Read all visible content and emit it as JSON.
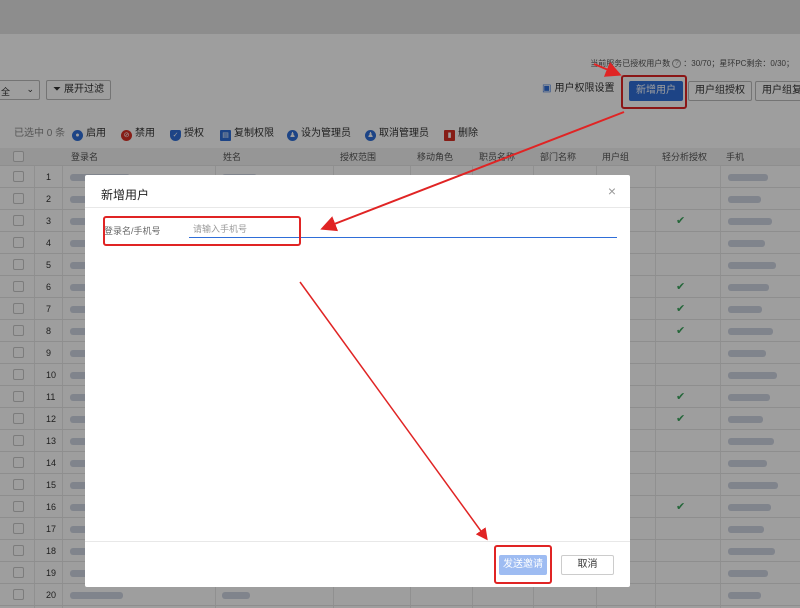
{
  "header": {
    "info_prefix": "当前服务已授权用户数",
    "info_help_icon": "?",
    "info_rest": "：30/70；星环PC剩余：0/30；"
  },
  "filter": {
    "select_value": "全",
    "expand_filter_label": "展开过滤"
  },
  "toolbar": {
    "permission_settings_label": "用户权限设置",
    "new_user_label": "新增用户",
    "group_auth_label": "用户组授权",
    "group_copy_label": "用户组复制"
  },
  "actions": {
    "selected_count": "已选中 0 条",
    "enable": "启用",
    "disable": "禁用",
    "authorize": "授权",
    "copy_permission": "复制权限",
    "set_admin": "设为管理员",
    "unset_admin": "取消管理员",
    "delete": "删除"
  },
  "table": {
    "columns": [
      "登录名",
      "姓名",
      "授权范围",
      "移动角色",
      "职员名称",
      "部门名称",
      "用户组",
      "轻分析授权",
      "手机"
    ],
    "rows": [
      {
        "index": "1",
        "checked": false
      },
      {
        "index": "2",
        "checked": false
      },
      {
        "index": "3",
        "checked": true
      },
      {
        "index": "4",
        "checked": false
      },
      {
        "index": "5",
        "checked": false
      },
      {
        "index": "6",
        "checked": true
      },
      {
        "index": "7",
        "checked": true
      },
      {
        "index": "8",
        "checked": true
      },
      {
        "index": "9",
        "checked": false
      },
      {
        "index": "10",
        "checked": false
      },
      {
        "index": "11",
        "checked": true
      },
      {
        "index": "12",
        "checked": true
      },
      {
        "index": "13",
        "checked": false
      },
      {
        "index": "14",
        "checked": false
      },
      {
        "index": "15",
        "checked": false
      },
      {
        "index": "16",
        "checked": true
      },
      {
        "index": "17",
        "checked": false
      },
      {
        "index": "18",
        "checked": false
      },
      {
        "index": "19",
        "checked": false
      },
      {
        "index": "20",
        "checked": false
      }
    ]
  },
  "modal": {
    "title": "新增用户",
    "close_icon": "×",
    "field_label": "登录名/手机号",
    "field_placeholder": "请输入手机号",
    "field_value": "",
    "send_invite_label": "发送邀请",
    "cancel_label": "取消"
  },
  "colors": {
    "primary": "#2f6ed8",
    "annotation_red": "#e02424",
    "check_green": "#3aa55d"
  }
}
